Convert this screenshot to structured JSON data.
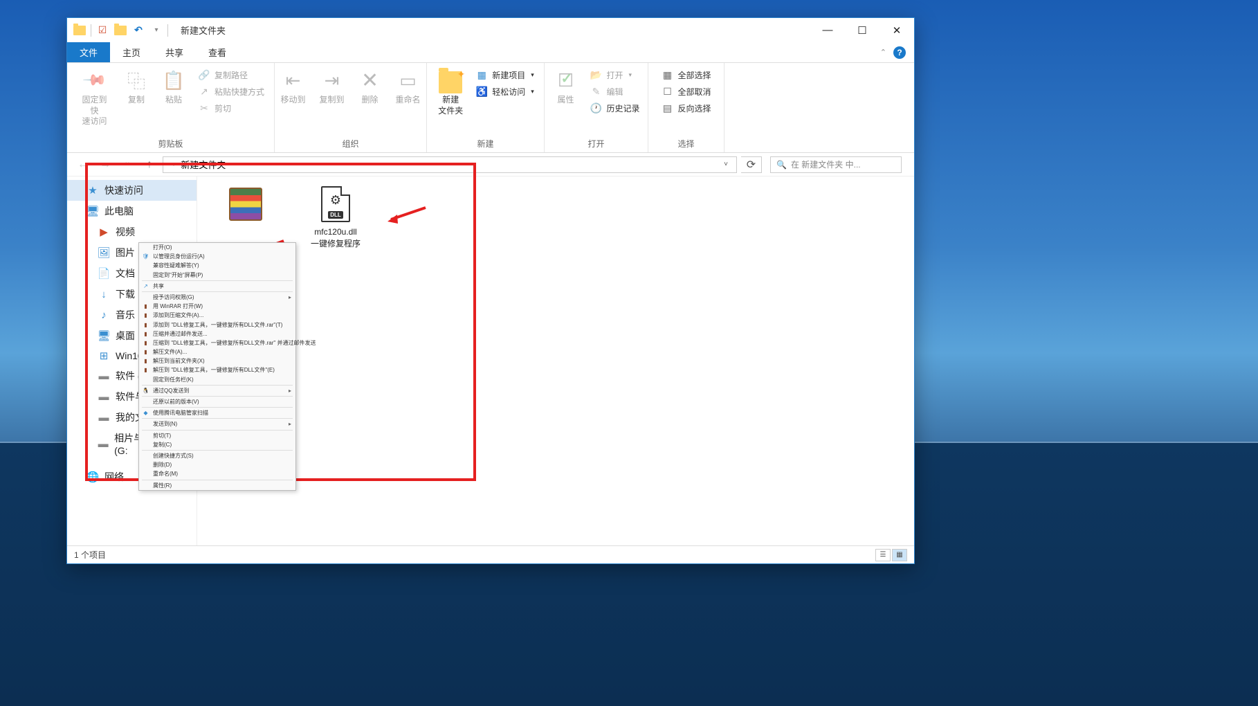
{
  "titlebar": {
    "title": "新建文件夹"
  },
  "tabs": {
    "file": "文件",
    "home": "主页",
    "share": "共享",
    "view": "查看"
  },
  "ribbon": {
    "clipboard": {
      "pin": "固定到快\n速访问",
      "copy": "复制",
      "paste": "粘贴",
      "copy_path": "复制路径",
      "paste_shortcut": "粘贴快捷方式",
      "cut": "剪切",
      "group_label": "剪贴板"
    },
    "organize": {
      "move_to": "移动到",
      "copy_to": "复制到",
      "delete": "删除",
      "rename": "重命名",
      "group_label": "组织"
    },
    "new": {
      "new_folder": "新建\n文件夹",
      "new_item": "新建项目",
      "easy_access": "轻松访问",
      "group_label": "新建"
    },
    "open": {
      "properties": "属性",
      "open": "打开",
      "edit": "编辑",
      "history": "历史记录",
      "group_label": "打开"
    },
    "select": {
      "select_all": "全部选择",
      "select_none": "全部取消",
      "invert": "反向选择",
      "group_label": "选择"
    }
  },
  "addressbar": {
    "location": "新建文件夹",
    "search_placeholder": "在 新建文件夹 中..."
  },
  "sidebar": {
    "items": [
      {
        "icon": "star",
        "label": "快速访问"
      },
      {
        "icon": "pc",
        "label": "此电脑"
      },
      {
        "icon": "video",
        "label": "视频"
      },
      {
        "icon": "pic",
        "label": "图片"
      },
      {
        "icon": "doc",
        "label": "文档"
      },
      {
        "icon": "download",
        "label": "下载"
      },
      {
        "icon": "music",
        "label": "音乐"
      },
      {
        "icon": "desktop",
        "label": "桌面"
      },
      {
        "icon": "win",
        "label": "Win10"
      },
      {
        "icon": "drive",
        "label": "软件 (D"
      },
      {
        "icon": "drive",
        "label": "软件与"
      },
      {
        "icon": "drive",
        "label": "我的文"
      },
      {
        "icon": "drive",
        "label": "相片与其他文件 (G:"
      },
      {
        "icon": "network",
        "label": "网络"
      }
    ]
  },
  "files": {
    "item1": {
      "name1": "mfc120u.dll",
      "name2": "一键修复程序"
    }
  },
  "context_menu": {
    "items": [
      {
        "label": "打开(O)",
        "sep_after": false
      },
      {
        "label": "以管理员身份运行(A)",
        "icon": "shield"
      },
      {
        "label": "兼容性疑难解答(Y)"
      },
      {
        "label": "固定到\"开始\"屏幕(P)"
      },
      {
        "label": "共享",
        "icon": "share",
        "sep_before": true,
        "sep_after": true
      },
      {
        "label": "授予访问权限(G)",
        "arrow": true
      },
      {
        "label": "用 WinRAR 打开(W)",
        "icon": "rar"
      },
      {
        "label": "添加到压缩文件(A)...",
        "icon": "rar"
      },
      {
        "label": "添加到 \"DLL修复工具，一键修复所有DLL文件.rar\"(T)",
        "icon": "rar"
      },
      {
        "label": "压缩并通过邮件发送...",
        "icon": "rar"
      },
      {
        "label": "压缩到 \"DLL修复工具，一键修复所有DLL文件.rar\" 并通过邮件发送",
        "icon": "rar"
      },
      {
        "label": "解压文件(A)...",
        "icon": "rar"
      },
      {
        "label": "解压到当前文件夹(X)",
        "icon": "rar"
      },
      {
        "label": "解压到 \"DLL修复工具，一键修复所有DLL文件\"(E)",
        "icon": "rar"
      },
      {
        "label": "固定到任务栏(K)",
        "sep_after": true
      },
      {
        "label": "通过QQ发送到",
        "icon": "qq",
        "arrow": true,
        "sep_after": true
      },
      {
        "label": "还原以前的版本(V)",
        "sep_after": true
      },
      {
        "label": "使用腾讯电脑管家扫描",
        "icon": "tencent",
        "sep_after": true
      },
      {
        "label": "发送到(N)",
        "arrow": true,
        "sep_after": true
      },
      {
        "label": "剪切(T)"
      },
      {
        "label": "复制(C)",
        "sep_after": true
      },
      {
        "label": "创建快捷方式(S)"
      },
      {
        "label": "删除(D)"
      },
      {
        "label": "重命名(M)",
        "sep_after": true
      },
      {
        "label": "属性(R)"
      }
    ]
  },
  "statusbar": {
    "count": "1 个项目"
  }
}
